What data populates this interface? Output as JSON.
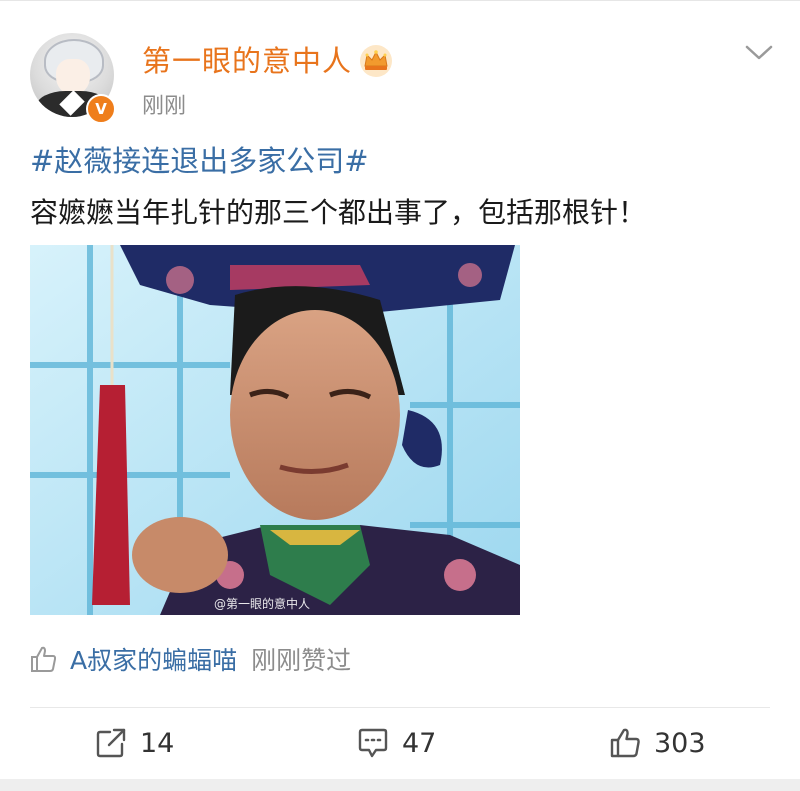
{
  "post": {
    "username": "第一眼的意中人",
    "time": "刚刚",
    "verified_badge": "V",
    "topic": "#赵薇接连退出多家公司#",
    "text": "容嬷嬷当年扎针的那三个都出事了，包括那根针！",
    "image": {
      "description": "still of an elderly woman in Qing-dynasty headdress holding a needle with red tassel",
      "watermark": "@第一眼的意中人"
    }
  },
  "likes_line": {
    "liker": "A叔家的蝙蝠喵",
    "text": "刚刚赞过"
  },
  "actions": {
    "share_count": "14",
    "comment_count": "47",
    "like_count": "303"
  },
  "icons": {
    "crown": "crown-icon",
    "menu": "chevron-down-icon",
    "share": "share-icon",
    "comment": "comment-icon",
    "like": "thumbs-up-icon"
  },
  "colors": {
    "username": "#e8741c",
    "topic": "#3a6ea5",
    "verified": "#ef7e1b",
    "muted": "#8c8c8c"
  }
}
